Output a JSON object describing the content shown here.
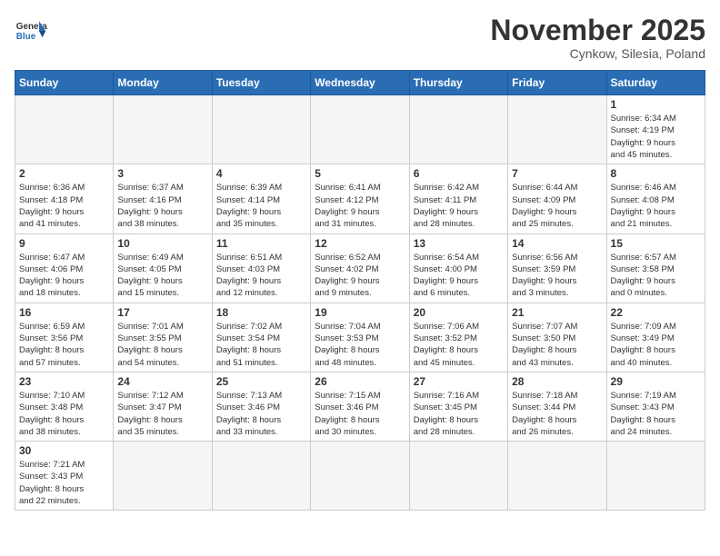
{
  "header": {
    "logo_general": "General",
    "logo_blue": "Blue",
    "month_year": "November 2025",
    "location": "Cynkow, Silesia, Poland"
  },
  "weekdays": [
    "Sunday",
    "Monday",
    "Tuesday",
    "Wednesday",
    "Thursday",
    "Friday",
    "Saturday"
  ],
  "weeks": [
    [
      {
        "day": "",
        "info": ""
      },
      {
        "day": "",
        "info": ""
      },
      {
        "day": "",
        "info": ""
      },
      {
        "day": "",
        "info": ""
      },
      {
        "day": "",
        "info": ""
      },
      {
        "day": "",
        "info": ""
      },
      {
        "day": "1",
        "info": "Sunrise: 6:34 AM\nSunset: 4:19 PM\nDaylight: 9 hours\nand 45 minutes."
      }
    ],
    [
      {
        "day": "2",
        "info": "Sunrise: 6:36 AM\nSunset: 4:18 PM\nDaylight: 9 hours\nand 41 minutes."
      },
      {
        "day": "3",
        "info": "Sunrise: 6:37 AM\nSunset: 4:16 PM\nDaylight: 9 hours\nand 38 minutes."
      },
      {
        "day": "4",
        "info": "Sunrise: 6:39 AM\nSunset: 4:14 PM\nDaylight: 9 hours\nand 35 minutes."
      },
      {
        "day": "5",
        "info": "Sunrise: 6:41 AM\nSunset: 4:12 PM\nDaylight: 9 hours\nand 31 minutes."
      },
      {
        "day": "6",
        "info": "Sunrise: 6:42 AM\nSunset: 4:11 PM\nDaylight: 9 hours\nand 28 minutes."
      },
      {
        "day": "7",
        "info": "Sunrise: 6:44 AM\nSunset: 4:09 PM\nDaylight: 9 hours\nand 25 minutes."
      },
      {
        "day": "8",
        "info": "Sunrise: 6:46 AM\nSunset: 4:08 PM\nDaylight: 9 hours\nand 21 minutes."
      }
    ],
    [
      {
        "day": "9",
        "info": "Sunrise: 6:47 AM\nSunset: 4:06 PM\nDaylight: 9 hours\nand 18 minutes."
      },
      {
        "day": "10",
        "info": "Sunrise: 6:49 AM\nSunset: 4:05 PM\nDaylight: 9 hours\nand 15 minutes."
      },
      {
        "day": "11",
        "info": "Sunrise: 6:51 AM\nSunset: 4:03 PM\nDaylight: 9 hours\nand 12 minutes."
      },
      {
        "day": "12",
        "info": "Sunrise: 6:52 AM\nSunset: 4:02 PM\nDaylight: 9 hours\nand 9 minutes."
      },
      {
        "day": "13",
        "info": "Sunrise: 6:54 AM\nSunset: 4:00 PM\nDaylight: 9 hours\nand 6 minutes."
      },
      {
        "day": "14",
        "info": "Sunrise: 6:56 AM\nSunset: 3:59 PM\nDaylight: 9 hours\nand 3 minutes."
      },
      {
        "day": "15",
        "info": "Sunrise: 6:57 AM\nSunset: 3:58 PM\nDaylight: 9 hours\nand 0 minutes."
      }
    ],
    [
      {
        "day": "16",
        "info": "Sunrise: 6:59 AM\nSunset: 3:56 PM\nDaylight: 8 hours\nand 57 minutes."
      },
      {
        "day": "17",
        "info": "Sunrise: 7:01 AM\nSunset: 3:55 PM\nDaylight: 8 hours\nand 54 minutes."
      },
      {
        "day": "18",
        "info": "Sunrise: 7:02 AM\nSunset: 3:54 PM\nDaylight: 8 hours\nand 51 minutes."
      },
      {
        "day": "19",
        "info": "Sunrise: 7:04 AM\nSunset: 3:53 PM\nDaylight: 8 hours\nand 48 minutes."
      },
      {
        "day": "20",
        "info": "Sunrise: 7:06 AM\nSunset: 3:52 PM\nDaylight: 8 hours\nand 45 minutes."
      },
      {
        "day": "21",
        "info": "Sunrise: 7:07 AM\nSunset: 3:50 PM\nDaylight: 8 hours\nand 43 minutes."
      },
      {
        "day": "22",
        "info": "Sunrise: 7:09 AM\nSunset: 3:49 PM\nDaylight: 8 hours\nand 40 minutes."
      }
    ],
    [
      {
        "day": "23",
        "info": "Sunrise: 7:10 AM\nSunset: 3:48 PM\nDaylight: 8 hours\nand 38 minutes."
      },
      {
        "day": "24",
        "info": "Sunrise: 7:12 AM\nSunset: 3:47 PM\nDaylight: 8 hours\nand 35 minutes."
      },
      {
        "day": "25",
        "info": "Sunrise: 7:13 AM\nSunset: 3:46 PM\nDaylight: 8 hours\nand 33 minutes."
      },
      {
        "day": "26",
        "info": "Sunrise: 7:15 AM\nSunset: 3:46 PM\nDaylight: 8 hours\nand 30 minutes."
      },
      {
        "day": "27",
        "info": "Sunrise: 7:16 AM\nSunset: 3:45 PM\nDaylight: 8 hours\nand 28 minutes."
      },
      {
        "day": "28",
        "info": "Sunrise: 7:18 AM\nSunset: 3:44 PM\nDaylight: 8 hours\nand 26 minutes."
      },
      {
        "day": "29",
        "info": "Sunrise: 7:19 AM\nSunset: 3:43 PM\nDaylight: 8 hours\nand 24 minutes."
      }
    ],
    [
      {
        "day": "30",
        "info": "Sunrise: 7:21 AM\nSunset: 3:43 PM\nDaylight: 8 hours\nand 22 minutes."
      },
      {
        "day": "",
        "info": ""
      },
      {
        "day": "",
        "info": ""
      },
      {
        "day": "",
        "info": ""
      },
      {
        "day": "",
        "info": ""
      },
      {
        "day": "",
        "info": ""
      },
      {
        "day": "",
        "info": ""
      }
    ]
  ]
}
